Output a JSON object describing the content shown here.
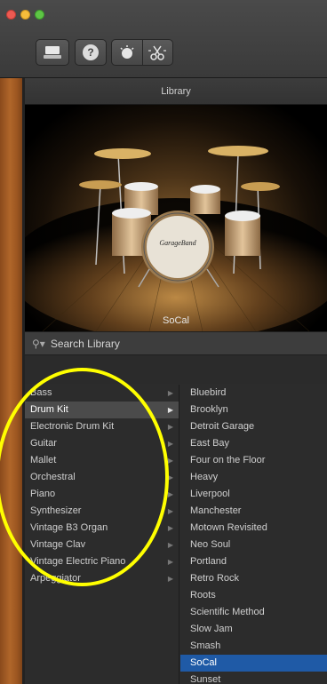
{
  "toolbar": {
    "library_icon": "library-icon",
    "help_label": "?",
    "smart_controls_icon": "dial-icon",
    "editors_icon": "scissors-icon"
  },
  "library": {
    "title": "Library",
    "preview_label": "SoCal",
    "drum_brand_text": "GarageBand",
    "search_placeholder": "Search Library",
    "categories": [
      {
        "label": "Bass",
        "has_arrow": true
      },
      {
        "label": "Drum Kit",
        "has_arrow": true,
        "selected": true
      },
      {
        "label": "Electronic Drum Kit",
        "has_arrow": true
      },
      {
        "label": "Guitar",
        "has_arrow": true
      },
      {
        "label": "Mallet",
        "has_arrow": true
      },
      {
        "label": "Orchestral",
        "has_arrow": true
      },
      {
        "label": "Piano",
        "has_arrow": true
      },
      {
        "label": "Synthesizer",
        "has_arrow": true
      },
      {
        "label": "Vintage B3 Organ",
        "has_arrow": true
      },
      {
        "label": "Vintage Clav",
        "has_arrow": true
      },
      {
        "label": "Vintage Electric Piano",
        "has_arrow": true
      },
      {
        "label": "Arpeggiator",
        "has_arrow": true
      }
    ],
    "presets": [
      {
        "label": "Bluebird"
      },
      {
        "label": "Brooklyn"
      },
      {
        "label": "Detroit Garage"
      },
      {
        "label": "East Bay"
      },
      {
        "label": "Four on the Floor"
      },
      {
        "label": "Heavy"
      },
      {
        "label": "Liverpool"
      },
      {
        "label": "Manchester"
      },
      {
        "label": "Motown Revisited"
      },
      {
        "label": "Neo Soul"
      },
      {
        "label": "Portland"
      },
      {
        "label": "Retro Rock"
      },
      {
        "label": "Roots"
      },
      {
        "label": "Scientific Method"
      },
      {
        "label": "Slow Jam"
      },
      {
        "label": "Smash"
      },
      {
        "label": "SoCal",
        "selected": true
      },
      {
        "label": "Sunset"
      }
    ]
  },
  "colors": {
    "selection_blue": "#1f5aa6",
    "annotation": "#ffff00"
  }
}
